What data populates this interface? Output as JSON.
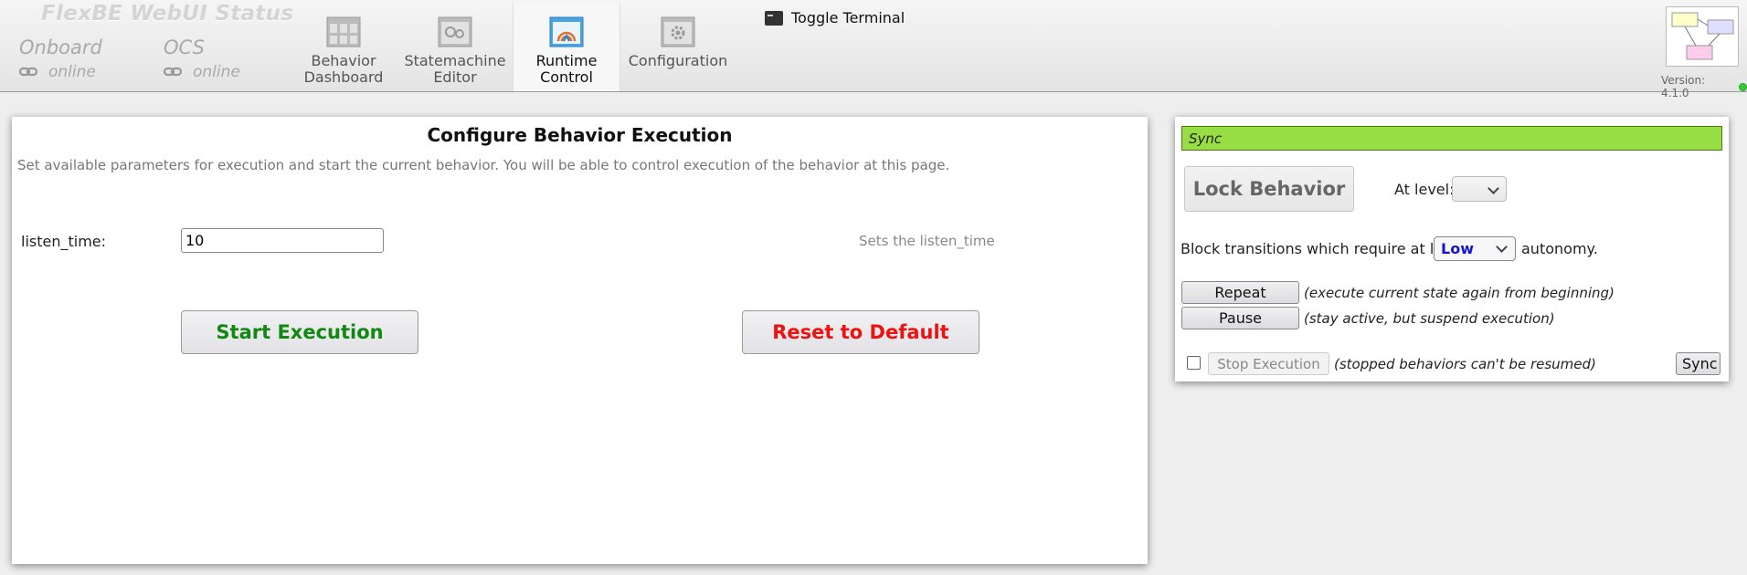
{
  "header": {
    "status_title": "FlexBE  WebUI Status",
    "onboard": {
      "name": "Onboard",
      "state": "online"
    },
    "ocs": {
      "name": "OCS",
      "state": "online"
    },
    "tabs": [
      {
        "label": "Behavior Dashboard",
        "icon": "dashboard-icon"
      },
      {
        "label": "Statemachine Editor",
        "icon": "statemachine-icon"
      },
      {
        "label": "Runtime Control",
        "icon": "runtime-icon",
        "active": true
      },
      {
        "label": "Configuration",
        "icon": "gear-icon"
      }
    ],
    "toggle_terminal": "Toggle Terminal",
    "version": "Version: 4.1.0",
    "version_status_color": "#33cc33"
  },
  "config": {
    "title": "Configure Behavior Execution",
    "description": "Set available parameters for execution and start the current behavior. You will be able to control execution of the behavior at this page.",
    "params": [
      {
        "label": "listen_time:",
        "value": "10",
        "hint": "Sets the listen_time"
      }
    ],
    "start_label": "Start Execution",
    "reset_label": "Reset to Default"
  },
  "control": {
    "sync_status": "Sync",
    "lock_label": "Lock Behavior",
    "level_label": "At level:",
    "level_value": "",
    "block_prefix": "Block transitions which require at least",
    "autonomy_value": "Low",
    "block_suffix": "autonomy.",
    "repeat_label": "Repeat",
    "repeat_note": "(execute current state again from beginning)",
    "pause_label": "Pause",
    "pause_note": "(stay active, but suspend execution)",
    "stop_label": "Stop Execution",
    "stop_note": "(stopped behaviors can't be resumed)",
    "sync_label": "Sync"
  },
  "colors": {
    "sync_bar": "#99dd44",
    "start_text": "#118811",
    "reset_text": "#ee1111",
    "autonomy_text": "#1515cc"
  }
}
